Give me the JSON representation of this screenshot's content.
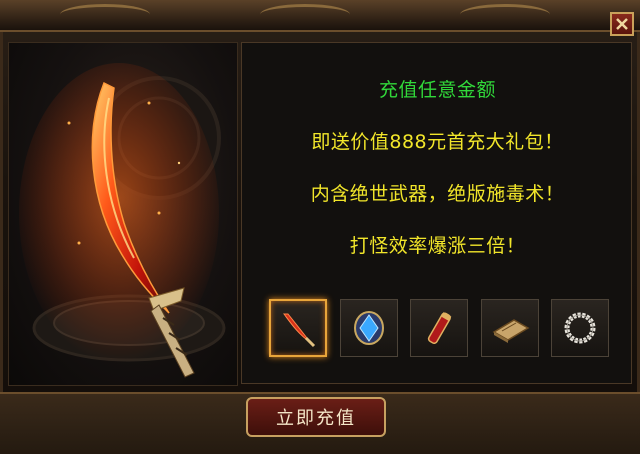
{
  "dialog": {
    "close_icon": "close-icon",
    "colors": {
      "green": "#31d83a",
      "yellow": "#f2e62a",
      "gold_border": "#e8a53a"
    }
  },
  "promo": {
    "line1": "充值任意金额",
    "line2": "即送价值888元首充大礼包！",
    "line3": "内含绝世武器，绝版施毒术！",
    "line4": "打怪效率爆涨三倍！"
  },
  "reward_slots": [
    {
      "icon": "blade-icon",
      "selected": true
    },
    {
      "icon": "blue-gem-icon",
      "selected": false
    },
    {
      "icon": "red-scroll-icon",
      "selected": false
    },
    {
      "icon": "skill-book-icon",
      "selected": false
    },
    {
      "icon": "bead-necklace-icon",
      "selected": false
    }
  ],
  "actions": {
    "recharge_label": "立即充值"
  }
}
